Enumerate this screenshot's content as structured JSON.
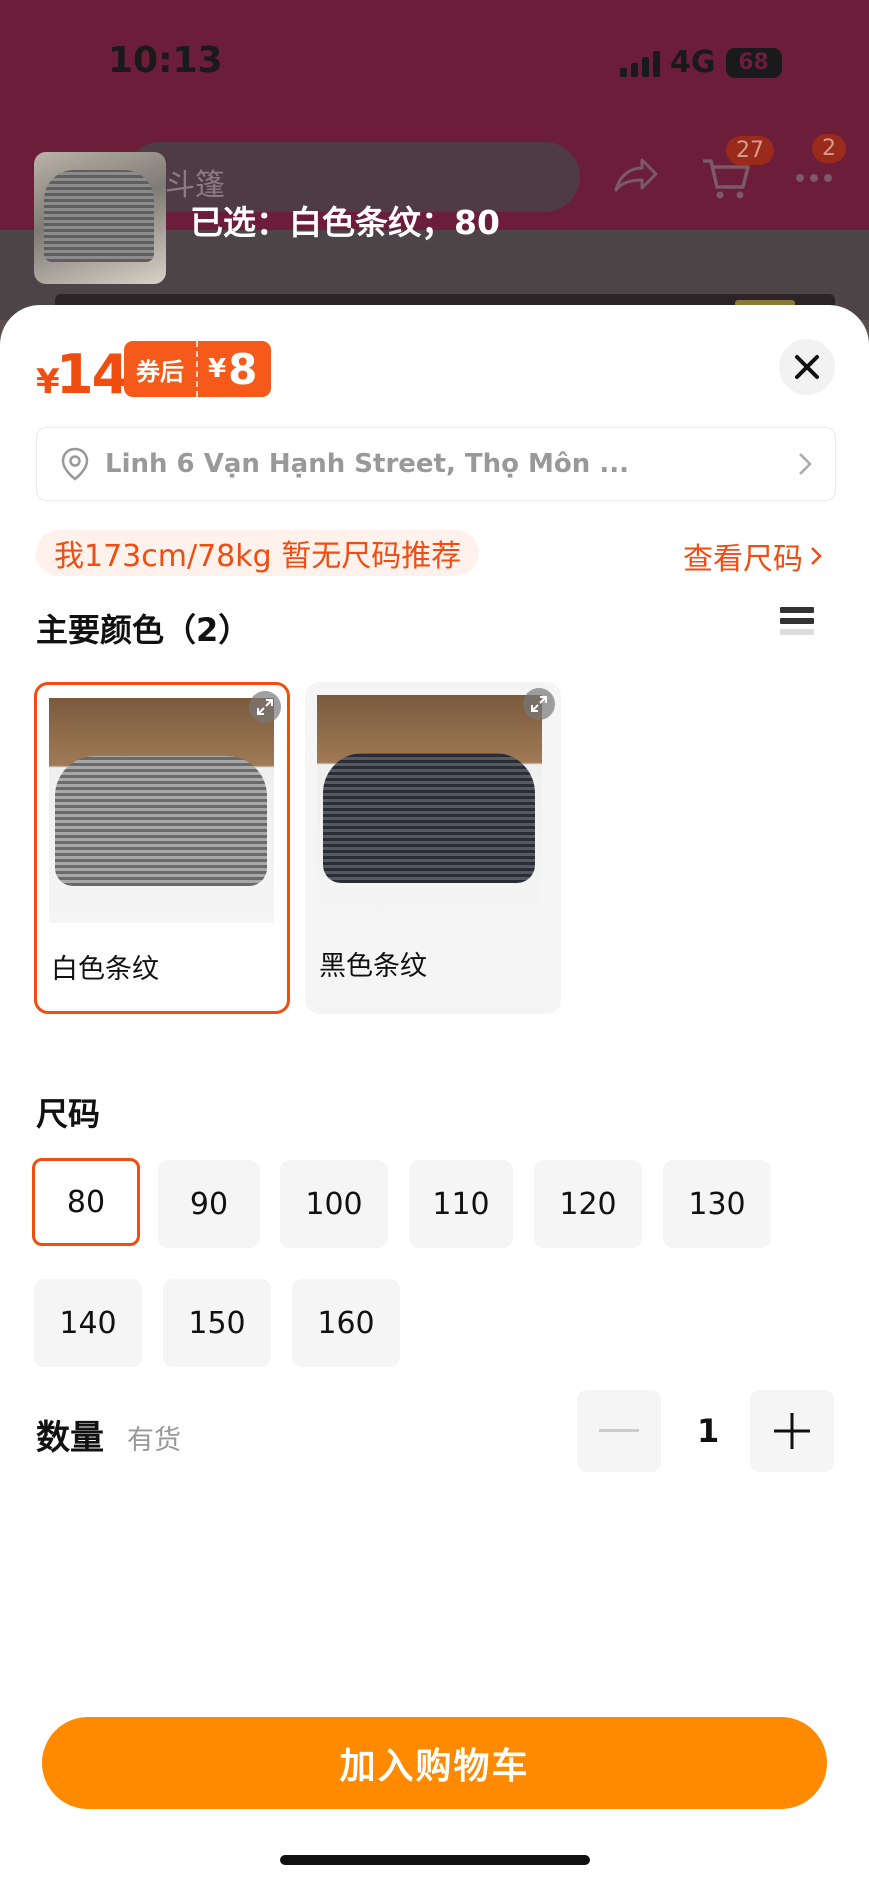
{
  "status_bar": {
    "time": "10:13",
    "network": "4G",
    "battery": "68"
  },
  "header": {
    "search_text": "斗篷",
    "selected_summary": "已选：白色条纹；80",
    "cart_badge": "27",
    "more_badge": "2"
  },
  "sheet": {
    "price_symbol": "¥",
    "price": "14",
    "coupon_label": "券后",
    "coupon_symbol": "¥",
    "coupon_price": "8",
    "address": "Linh 6 Vạn Hạnh Street, Thọ Môn ...",
    "size_recommendation": "我173cm/78kg 暂无尺码推荐",
    "size_chart_link": "查看尺码",
    "color_section_title": "主要颜色（2）",
    "colors": [
      {
        "name": "白色条纹",
        "selected": true
      },
      {
        "name": "黑色条纹",
        "selected": false
      }
    ],
    "size_section_title": "尺码",
    "sizes": [
      "80",
      "90",
      "100",
      "110",
      "120",
      "130",
      "140",
      "150",
      "160"
    ],
    "selected_size": "80",
    "quantity_label": "数量",
    "stock_status": "有货",
    "quantity": "1",
    "add_to_cart": "加入购物车"
  },
  "colors_theme": {
    "accent": "#f04e10",
    "button": "#ff8a00"
  }
}
